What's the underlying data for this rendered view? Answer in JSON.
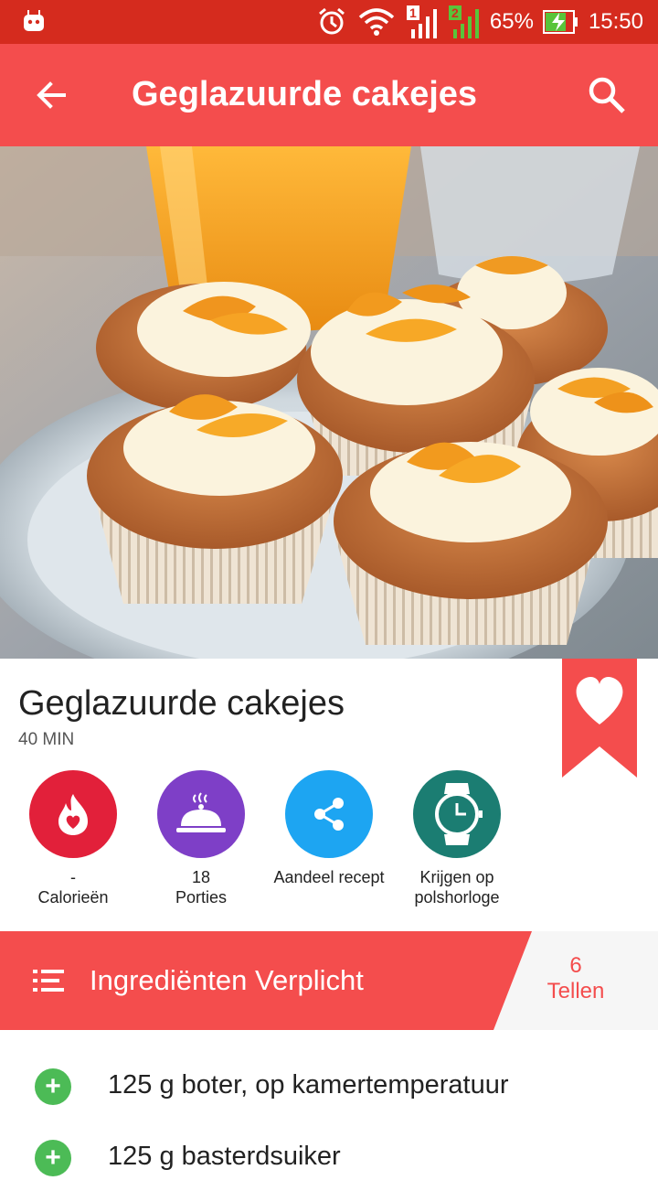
{
  "status_bar": {
    "battery": "65%",
    "time": "15:50",
    "sim1": "1",
    "sim2": "2"
  },
  "app_bar": {
    "title": "Geglazuurde cakejes",
    "back_icon": "arrow-left-icon",
    "search_icon": "search-icon"
  },
  "recipe": {
    "title": "Geglazuurde cakejes",
    "duration": "40 MIN",
    "favorite_icon": "heart-icon"
  },
  "actions": [
    {
      "value": "-",
      "label": "Calorieën",
      "icon": "flame-heart-icon",
      "color": "#e2203a"
    },
    {
      "value": "18",
      "label": "Porties",
      "icon": "serving-dish-icon",
      "color": "#7e3fc7"
    },
    {
      "value": "",
      "label": "Aandeel recept",
      "icon": "share-icon",
      "color": "#1da5f2"
    },
    {
      "value": "",
      "label": "Krijgen op polshorloge",
      "icon": "watch-icon",
      "color": "#1b7d72"
    }
  ],
  "ingredients_header": {
    "title": "Ingrediënten Verplicht",
    "count": "6",
    "count_label": "Tellen"
  },
  "ingredients": [
    {
      "text": "125 g boter, op kamertemperatuur"
    },
    {
      "text": "125 g basterdsuiker"
    }
  ],
  "colors": {
    "status_bar": "#d52b1e",
    "app_bar": "#f44d4d",
    "accent": "#f44d4d",
    "add_green": "#4cbb56"
  }
}
